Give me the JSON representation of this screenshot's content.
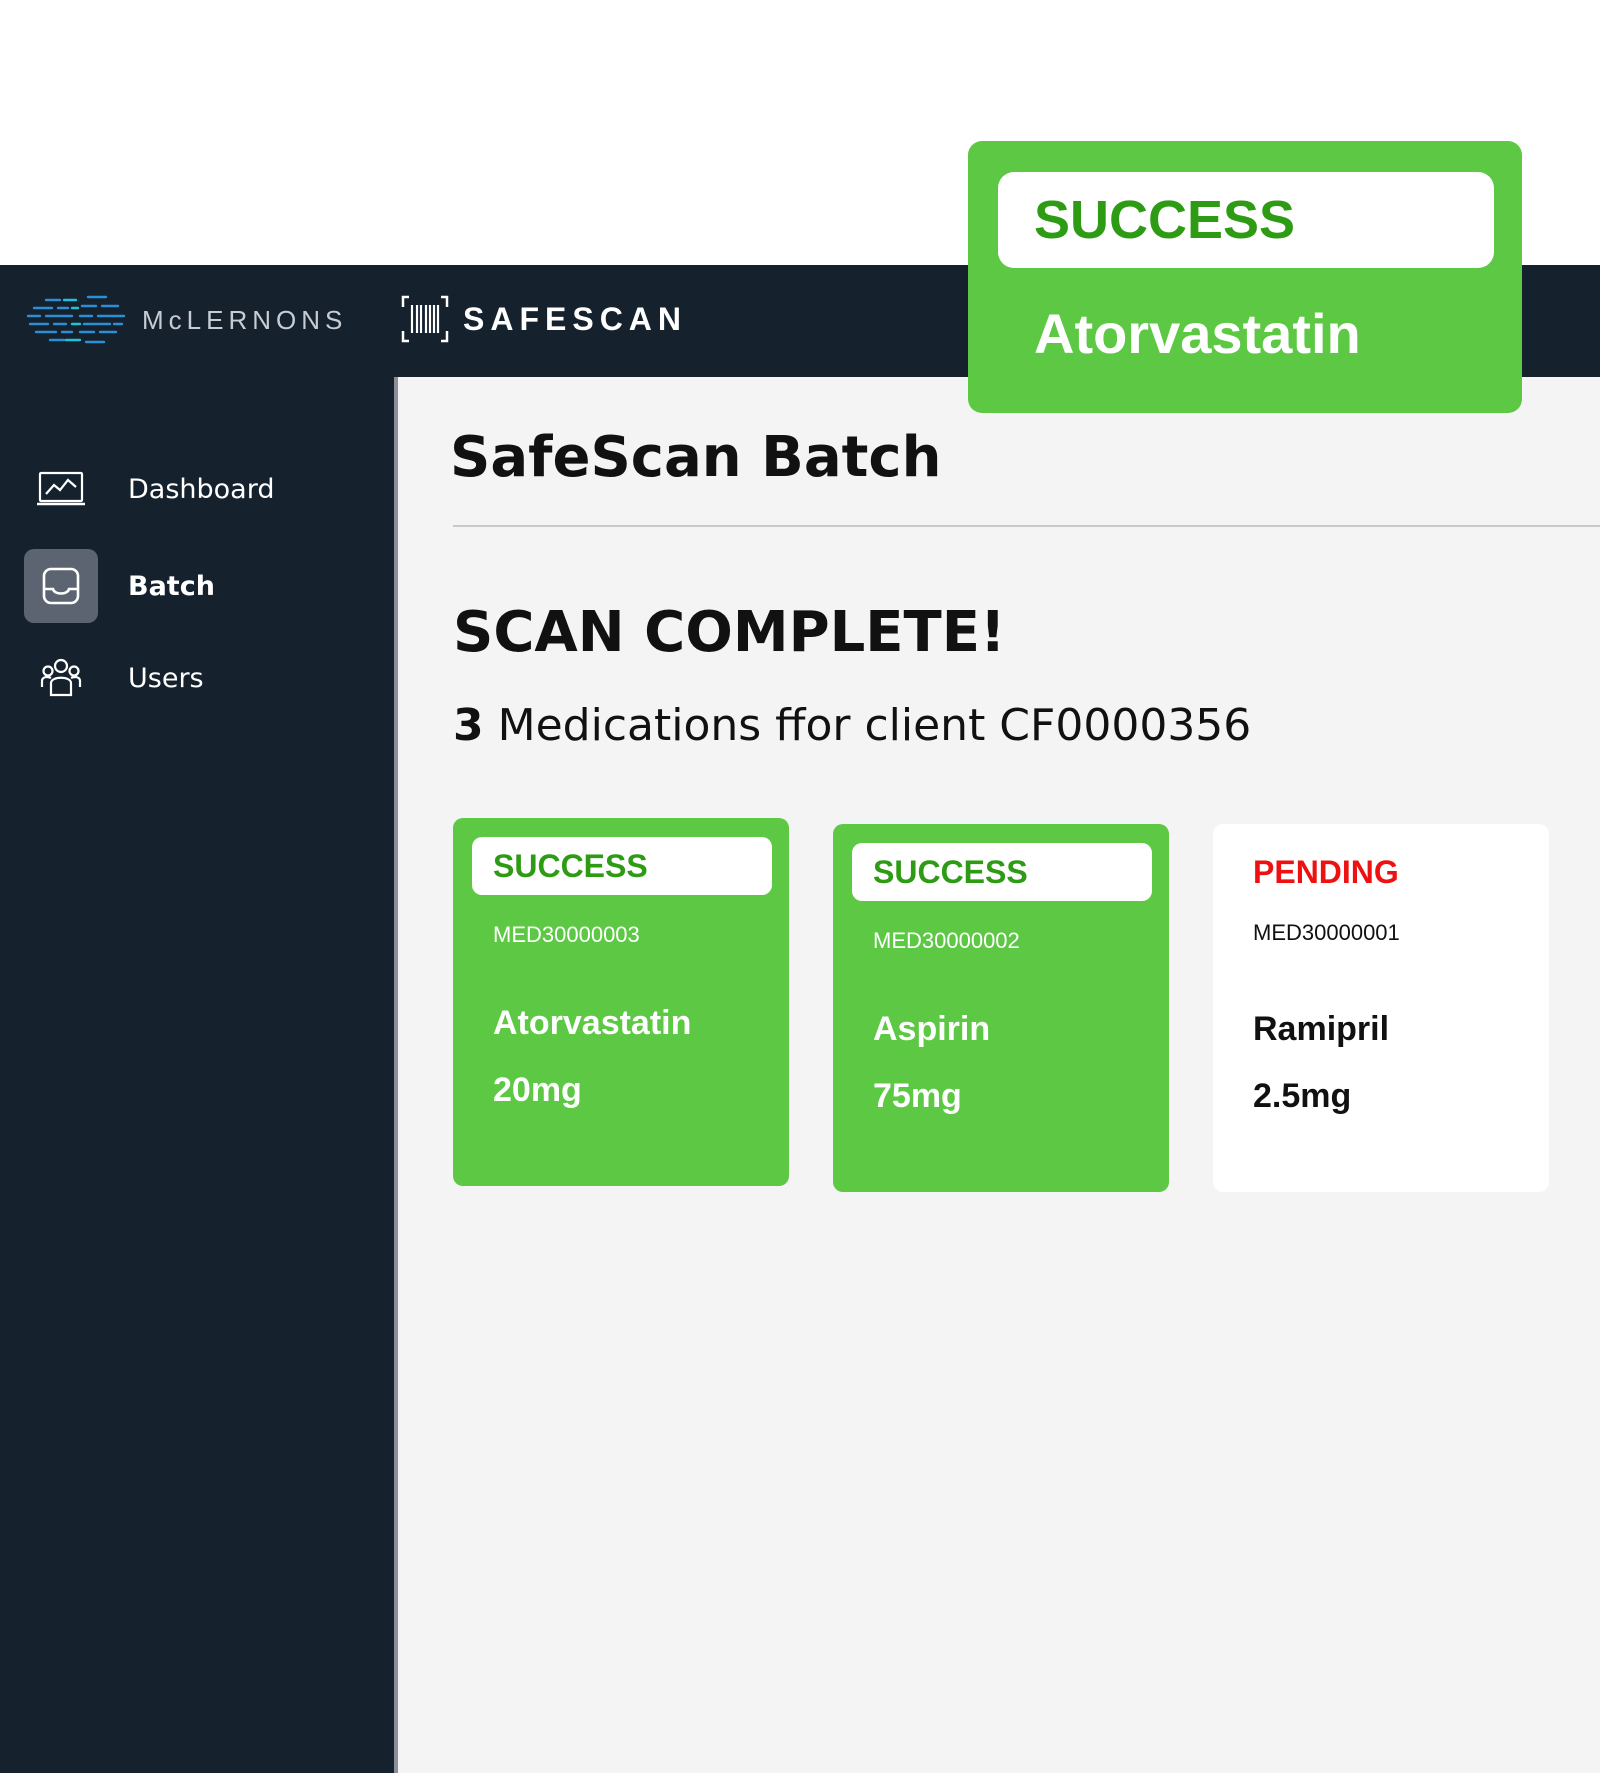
{
  "brand": {
    "company_name": "McLERNONS",
    "app_name": "SAFESCAN"
  },
  "sidebar": {
    "items": [
      {
        "label": "Dashboard",
        "icon": "chart-monitor-icon",
        "active": false
      },
      {
        "label": "Batch",
        "icon": "inbox-tray-icon",
        "active": true
      },
      {
        "label": "Users",
        "icon": "users-group-icon",
        "active": false
      }
    ]
  },
  "page": {
    "title": "SafeScan Batch",
    "scan_title": "SCAN COMPLETE!",
    "count": "3",
    "summary_text": "Medications ffor client CF0000356"
  },
  "medications": [
    {
      "status": "SUCCESS",
      "code": "MED30000003",
      "name": "Atorvastatin",
      "dose": "20mg"
    },
    {
      "status": "SUCCESS",
      "code": "MED30000002",
      "name": "Aspirin",
      "dose": "75mg"
    },
    {
      "status": "PENDING",
      "code": "MED30000001",
      "name": "Ramipril",
      "dose": "2.5mg"
    }
  ],
  "toast": {
    "status": "SUCCESS",
    "name": "Atorvastatin"
  },
  "colors": {
    "navy": "#16212e",
    "success_green": "#5dc843",
    "success_text": "#2e9b14",
    "pending_red": "#ee1111",
    "main_bg": "#f4f4f4"
  }
}
